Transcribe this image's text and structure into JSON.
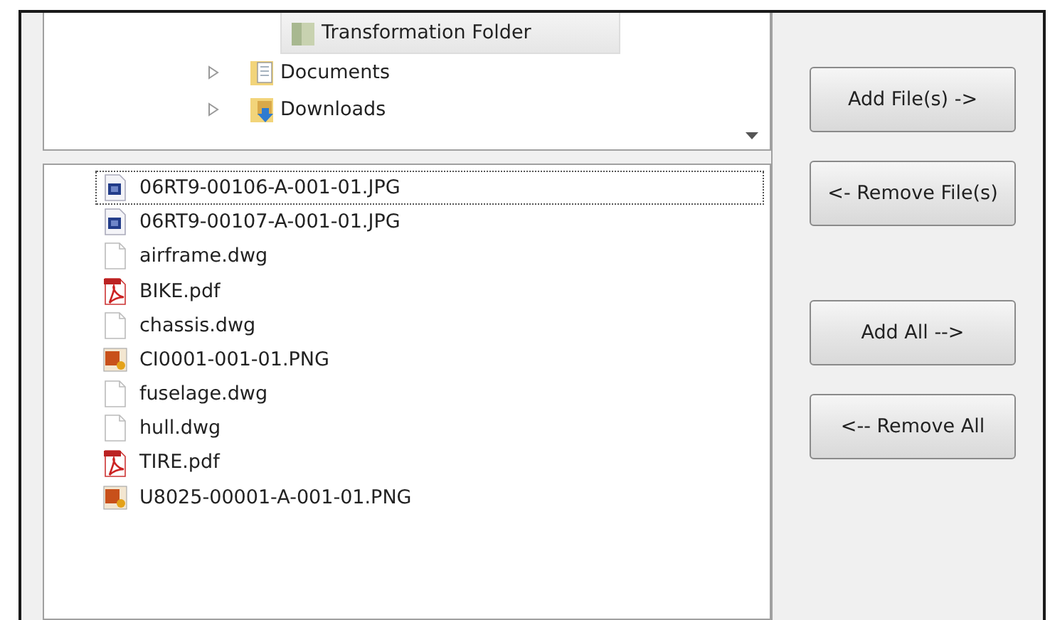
{
  "tree": {
    "items": [
      {
        "label": "Transformation Folder",
        "selected": true,
        "has_children": false
      },
      {
        "label": "Documents",
        "selected": false,
        "has_children": true
      },
      {
        "label": "Downloads",
        "selected": false,
        "has_children": true
      }
    ]
  },
  "files": [
    {
      "name": "06RT9-00106-A-001-01.JPG",
      "kind": "jpg",
      "focused": true
    },
    {
      "name": "06RT9-00107-A-001-01.JPG",
      "kind": "jpg",
      "focused": false
    },
    {
      "name": "airframe.dwg",
      "kind": "dwg",
      "focused": false
    },
    {
      "name": "BIKE.pdf",
      "kind": "pdf",
      "focused": false
    },
    {
      "name": "chassis.dwg",
      "kind": "dwg",
      "focused": false
    },
    {
      "name": "CI0001-001-01.PNG",
      "kind": "png",
      "focused": false
    },
    {
      "name": "fuselage.dwg",
      "kind": "dwg",
      "focused": false
    },
    {
      "name": "hull.dwg",
      "kind": "dwg",
      "focused": false
    },
    {
      "name": "TIRE.pdf",
      "kind": "pdf",
      "focused": false
    },
    {
      "name": "U8025-00001-A-001-01.PNG",
      "kind": "png",
      "focused": false
    }
  ],
  "buttons": [
    "Add File(s) ->",
    "<- Remove File(s)",
    "Add All -->",
    "<-- Remove All"
  ]
}
